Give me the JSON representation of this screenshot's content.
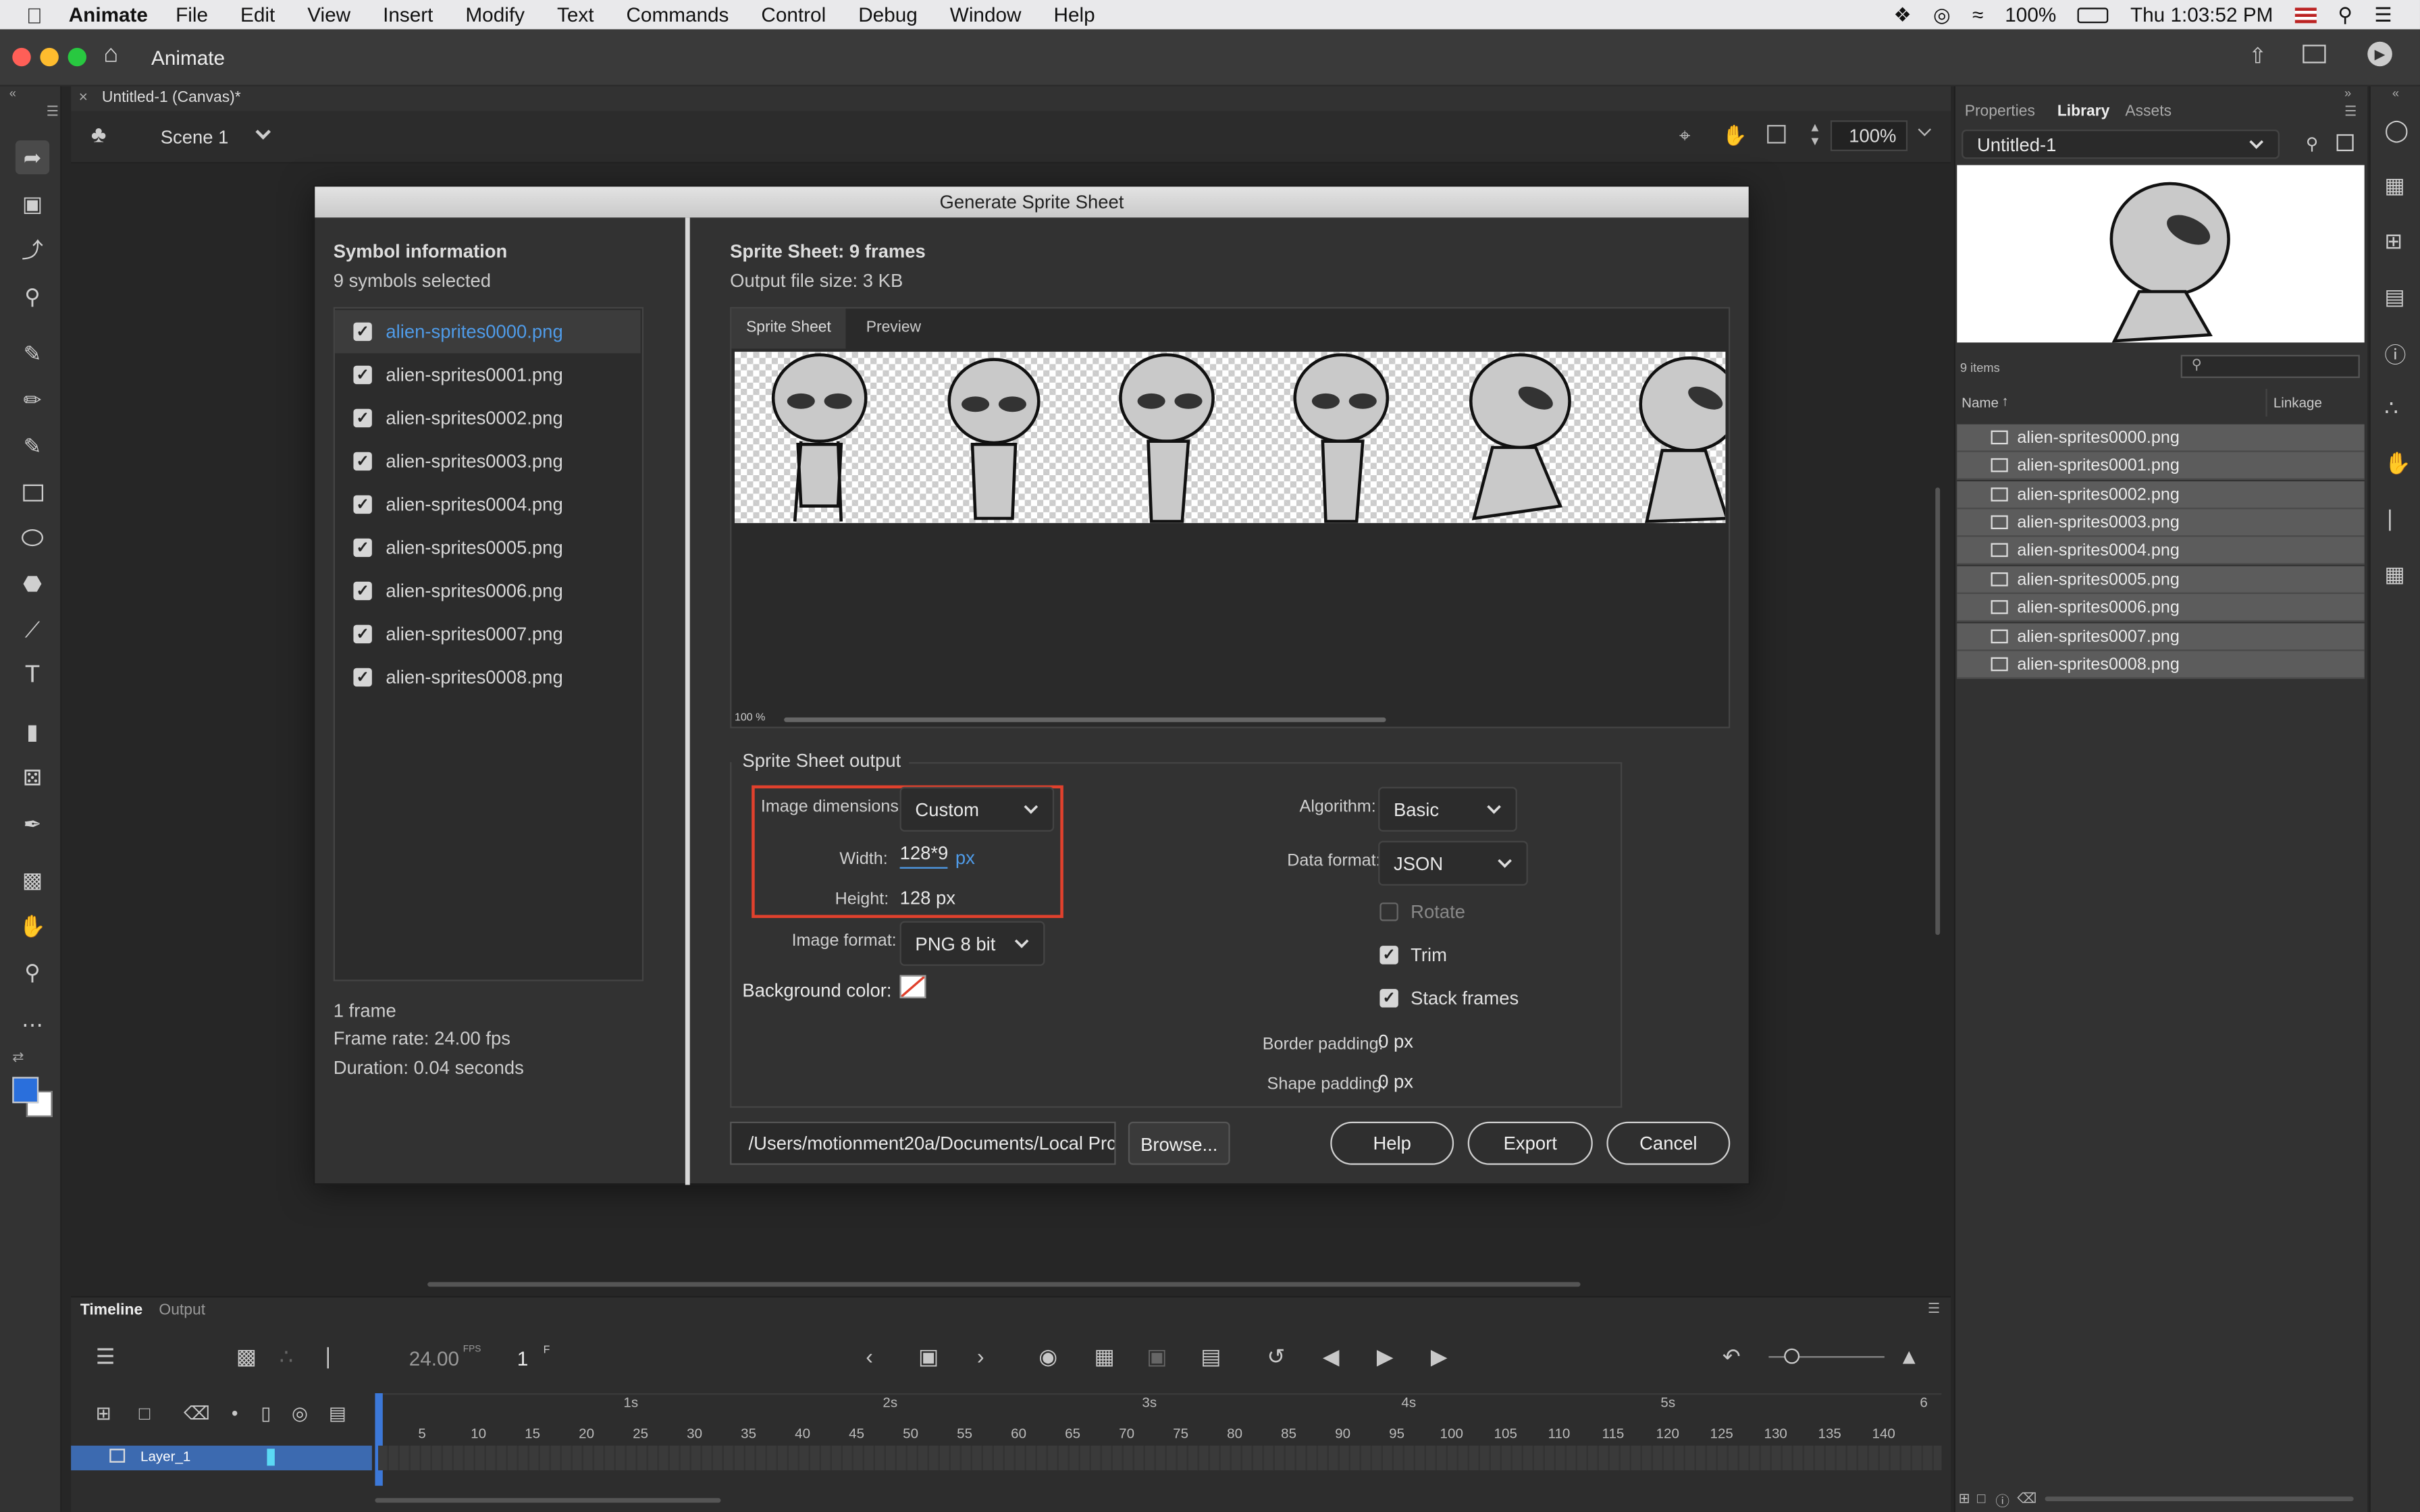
{
  "menubar": {
    "apple": "",
    "app_name": "Animate",
    "items": [
      "File",
      "Edit",
      "View",
      "Insert",
      "Modify",
      "Text",
      "Commands",
      "Control",
      "Debug",
      "Window",
      "Help"
    ],
    "battery": "100%",
    "clock": "Thu 1:03:52 PM"
  },
  "app": {
    "title": "Animate",
    "doc_tab": "Untitled-1 (Canvas)*",
    "scene": "Scene 1",
    "zoom": "100%"
  },
  "dialog": {
    "title": "Generate Sprite Sheet",
    "symbol_info": {
      "heading": "Symbol information",
      "count": "9 symbols selected",
      "symbols": [
        {
          "name": "alien-sprites0000.png",
          "checked": true,
          "selected": true
        },
        {
          "name": "alien-sprites0001.png",
          "checked": true
        },
        {
          "name": "alien-sprites0002.png",
          "checked": true
        },
        {
          "name": "alien-sprites0003.png",
          "checked": true
        },
        {
          "name": "alien-sprites0004.png",
          "checked": true
        },
        {
          "name": "alien-sprites0005.png",
          "checked": true
        },
        {
          "name": "alien-sprites0006.png",
          "checked": true
        },
        {
          "name": "alien-sprites0007.png",
          "checked": true
        },
        {
          "name": "alien-sprites0008.png",
          "checked": true
        }
      ],
      "frames": "1 frame",
      "frame_rate": "Frame rate: 24.00 fps",
      "duration": "Duration: 0.04 seconds"
    },
    "sheet": {
      "heading": "Sprite Sheet: 9 frames",
      "size": "Output file size: 3 KB",
      "tabs": [
        "Sprite Sheet",
        "Preview"
      ],
      "preview_zoom": "100 %"
    },
    "output": {
      "heading": "Sprite Sheet output",
      "image_dimensions_label": "Image dimensions:",
      "image_dimensions": "Custom",
      "width_label": "Width:",
      "width_value": "128*9",
      "width_unit": "px",
      "height_label": "Height:",
      "height_value": "128 px",
      "image_format_label": "Image format:",
      "image_format": "PNG 8 bit",
      "bg_label": "Background color:",
      "algorithm_label": "Algorithm:",
      "algorithm": "Basic",
      "data_format_label": "Data format:",
      "data_format": "JSON",
      "rotate": "Rotate",
      "trim": "Trim",
      "stack_frames": "Stack frames",
      "border_padding_label": "Border padding:",
      "border_padding": "0 px",
      "shape_padding_label": "Shape padding:",
      "shape_padding": "0 px"
    },
    "path": "/Users/motionment20a/Documents/Local Prc",
    "browse": "Browse...",
    "help": "Help",
    "export": "Export",
    "cancel": "Cancel"
  },
  "library": {
    "tabs": [
      "Properties",
      "Library",
      "Assets"
    ],
    "doc": "Untitled-1",
    "count": "9 items",
    "col_name": "Name",
    "col_linkage": "Linkage",
    "items": [
      "alien-sprites0000.png",
      "alien-sprites0001.png",
      "alien-sprites0002.png",
      "alien-sprites0003.png",
      "alien-sprites0004.png",
      "alien-sprites0005.png",
      "alien-sprites0006.png",
      "alien-sprites0007.png",
      "alien-sprites0008.png"
    ]
  },
  "timeline": {
    "tabs": [
      "Timeline",
      "Output"
    ],
    "fps": "24.00",
    "fps_unit": "FPS",
    "frame": "1",
    "frame_unit": "F",
    "layer": "Layer_1",
    "seconds": [
      "1s",
      "2s",
      "3s",
      "4s",
      "5s",
      "6"
    ],
    "frame_ticks": [
      "5",
      "10",
      "15",
      "20",
      "25",
      "30",
      "35",
      "40",
      "45",
      "50",
      "55",
      "60",
      "65",
      "70",
      "75",
      "80",
      "85",
      "90",
      "95",
      "100",
      "105",
      "110",
      "115",
      "120",
      "125",
      "130",
      "135",
      "140"
    ]
  },
  "colors": {
    "highlight_border": "#e0412d",
    "accent_blue": "#4f9be8",
    "fill_swatch": "#2a6fdc"
  }
}
